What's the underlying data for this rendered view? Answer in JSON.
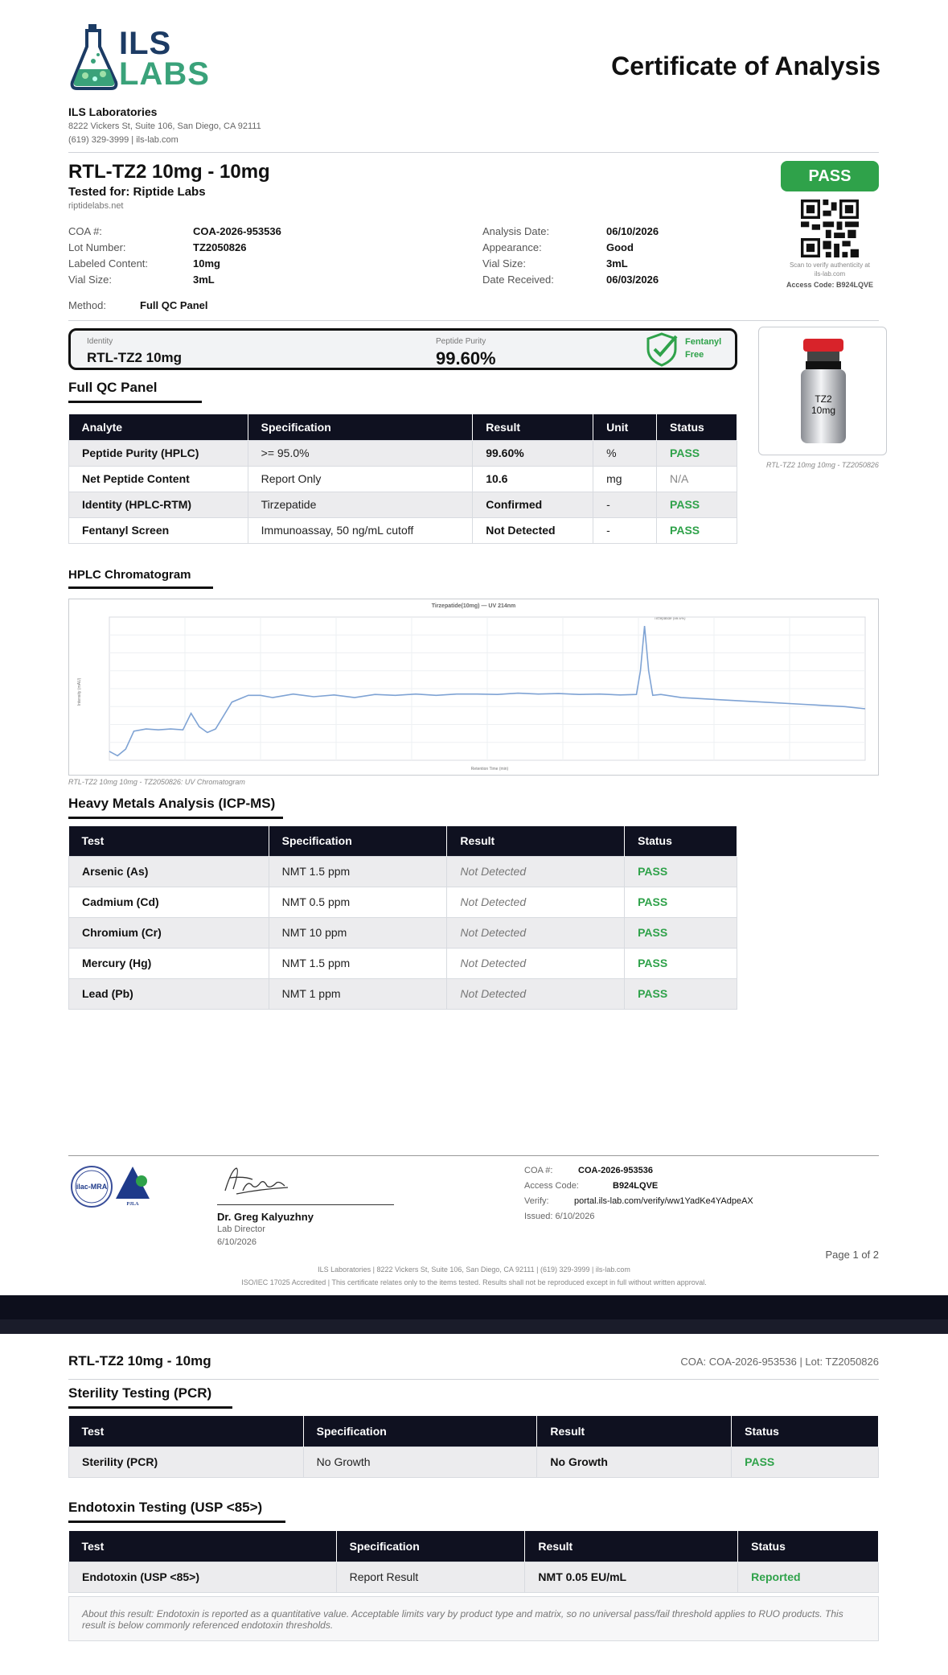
{
  "brand": {
    "logo_line1": "ILS",
    "logo_line2": "LABS",
    "company": "ILS Laboratories",
    "address": "8222 Vickers St, Suite 106, San Diego, CA 92111",
    "contact": "(619) 329-3999  |  ils-lab.com"
  },
  "doc_title": "Certificate of Analysis",
  "product": {
    "name": "RTL-TZ2 10mg - 10mg",
    "tested_for": "Tested for: Riptide Labs",
    "site": "riptidelabs.net"
  },
  "status_badge": "PASS",
  "qr": {
    "caption": "Scan to verify authenticity at ils-lab.com",
    "access_code": "Access Code: B924LQVE"
  },
  "info_left": [
    {
      "label": "COA #:",
      "value": "COA-2026-953536"
    },
    {
      "label": "Lot Number:",
      "value": "TZ2050826"
    },
    {
      "label": "Labeled Content:",
      "value": "10mg"
    },
    {
      "label": "Vial Size:",
      "value": "3mL"
    }
  ],
  "info_right": [
    {
      "label": "Analysis Date:",
      "value": "06/10/2026"
    },
    {
      "label": "Appearance:",
      "value": "Good"
    },
    {
      "label": "Vial Size:",
      "value": "3mL"
    },
    {
      "label": "Date Received:",
      "value": "06/03/2026"
    }
  ],
  "method": {
    "label": "Method:",
    "value": "Full QC Panel"
  },
  "summary": {
    "identity_label": "Identity",
    "identity_value": "RTL-TZ2 10mg",
    "purity_label": "Peptide Purity",
    "purity_value": "99.60%",
    "fentanyl_line1": "Fentanyl",
    "fentanyl_line2": "Free"
  },
  "vial": {
    "label_line1": "TZ2",
    "label_line2": "10mg",
    "caption": "RTL-TZ2 10mg 10mg - TZ2050826",
    "cap_color": "#d8232a"
  },
  "qc_panel": {
    "title": "Full QC Panel",
    "headers": [
      "Analyte",
      "Specification",
      "Result",
      "Unit",
      "Status"
    ],
    "rows": [
      [
        "Peptide Purity (HPLC)",
        ">= 95.0%",
        "99.60%",
        "%",
        "PASS"
      ],
      [
        "Net Peptide Content",
        "Report Only",
        "10.6",
        "mg",
        "N/A"
      ],
      [
        "Identity (HPLC-RTM)",
        "Tirzepatide",
        "Confirmed",
        "-",
        "PASS"
      ],
      [
        "Fentanyl Screen",
        "Immunoassay, 50 ng/mL cutoff",
        "Not Detected",
        "-",
        "PASS"
      ]
    ]
  },
  "hplc": {
    "title": "HPLC Chromatogram",
    "caption": "RTL-TZ2 10mg 10mg - TZ2050826: UV Chromatogram",
    "chart_title": "Tirzepatide(10mg) — UV 214nm",
    "peak_label": "Tirzepatide (99.6%)",
    "xlabel": "Retention Time (min)",
    "ylabel": "Intensity (mAU)",
    "line_color": "#7fa3d4"
  },
  "chart_data": {
    "type": "line",
    "title": "Tirzepatide(10mg) — UV 214nm",
    "xlabel": "Retention Time (min)",
    "ylabel": "Intensity (mAU)",
    "xlim": [
      0,
      18.5
    ],
    "ylim": [
      0,
      3200
    ],
    "x": [
      0,
      0.2,
      0.4,
      0.6,
      0.9,
      1.2,
      1.5,
      1.8,
      2.0,
      2.2,
      2.4,
      2.6,
      3.0,
      3.4,
      3.7,
      4.0,
      4.5,
      5.0,
      5.5,
      6.0,
      6.5,
      7.0,
      7.5,
      8.0,
      8.5,
      9.0,
      9.5,
      10.0,
      10.5,
      11.0,
      11.5,
      12.0,
      12.5,
      12.9,
      13.0,
      13.1,
      13.2,
      13.3,
      13.5,
      14.0,
      15.0,
      16.0,
      17.0,
      18.0,
      18.5
    ],
    "y": [
      200,
      100,
      250,
      650,
      700,
      680,
      700,
      680,
      1050,
      750,
      620,
      700,
      1300,
      1450,
      1450,
      1400,
      1480,
      1420,
      1460,
      1400,
      1470,
      1450,
      1480,
      1450,
      1480,
      1480,
      1470,
      1500,
      1480,
      1490,
      1470,
      1480,
      1460,
      1470,
      2000,
      3000,
      2000,
      1450,
      1470,
      1400,
      1350,
      1300,
      1250,
      1200,
      1150
    ]
  },
  "heavy_metals": {
    "title": "Heavy Metals Analysis (ICP-MS)",
    "headers": [
      "Test",
      "Specification",
      "Result",
      "Status"
    ],
    "rows": [
      [
        "Arsenic (As)",
        "NMT 1.5 ppm",
        "Not Detected",
        "PASS"
      ],
      [
        "Cadmium (Cd)",
        "NMT 0.5 ppm",
        "Not Detected",
        "PASS"
      ],
      [
        "Chromium (Cr)",
        "NMT 10 ppm",
        "Not Detected",
        "PASS"
      ],
      [
        "Mercury (Hg)",
        "NMT 1.5 ppm",
        "Not Detected",
        "PASS"
      ],
      [
        "Lead (Pb)",
        "NMT 1 ppm",
        "Not Detected",
        "PASS"
      ]
    ]
  },
  "signature": {
    "name": "Dr. Greg Kalyuzhny",
    "role": "Lab Director",
    "date": "6/10/2026",
    "accred1": "ilac-MRA",
    "accred2": "PJLA"
  },
  "verify": [
    {
      "label": "COA #:",
      "value": "COA-2026-953536"
    },
    {
      "label": "Access Code:",
      "value": "B924LQVE"
    },
    {
      "label": "Verify:",
      "value": "portal.ils-lab.com/verify/ww1YadKe4YAdpeAX"
    }
  ],
  "issued": "Issued: 6/10/2026",
  "page1_num": "Page 1 of 2",
  "footer_line1": "ILS Laboratories  |  8222 Vickers St, Suite 106, San Diego, CA 92111  |  (619) 329-3999  |  ils-lab.com",
  "footer_line2": "ISO/IEC 17025 Accredited  |  This certificate relates only to the items tested. Results shall not be reproduced except in full without written approval.",
  "page2": {
    "header_title": "RTL-TZ2 10mg - 10mg",
    "header_ref": "COA: COA-2026-953536  |  Lot: TZ2050826",
    "sterility": {
      "title": "Sterility Testing (PCR)",
      "headers": [
        "Test",
        "Specification",
        "Result",
        "Status"
      ],
      "rows": [
        [
          "Sterility (PCR)",
          "No Growth",
          "No Growth",
          "PASS"
        ]
      ]
    },
    "endotoxin": {
      "title": "Endotoxin Testing (USP <85>)",
      "headers": [
        "Test",
        "Specification",
        "Result",
        "Status"
      ],
      "rows": [
        [
          "Endotoxin (USP <85>)",
          "Report Result",
          "NMT 0.05 EU/mL",
          "Reported"
        ]
      ],
      "note": "About this result: Endotoxin is reported as a quantitative value. Acceptable limits vary by product type and matrix, so no universal pass/fail threshold applies to RUO products. This result is below commonly referenced endotoxin thresholds."
    }
  }
}
